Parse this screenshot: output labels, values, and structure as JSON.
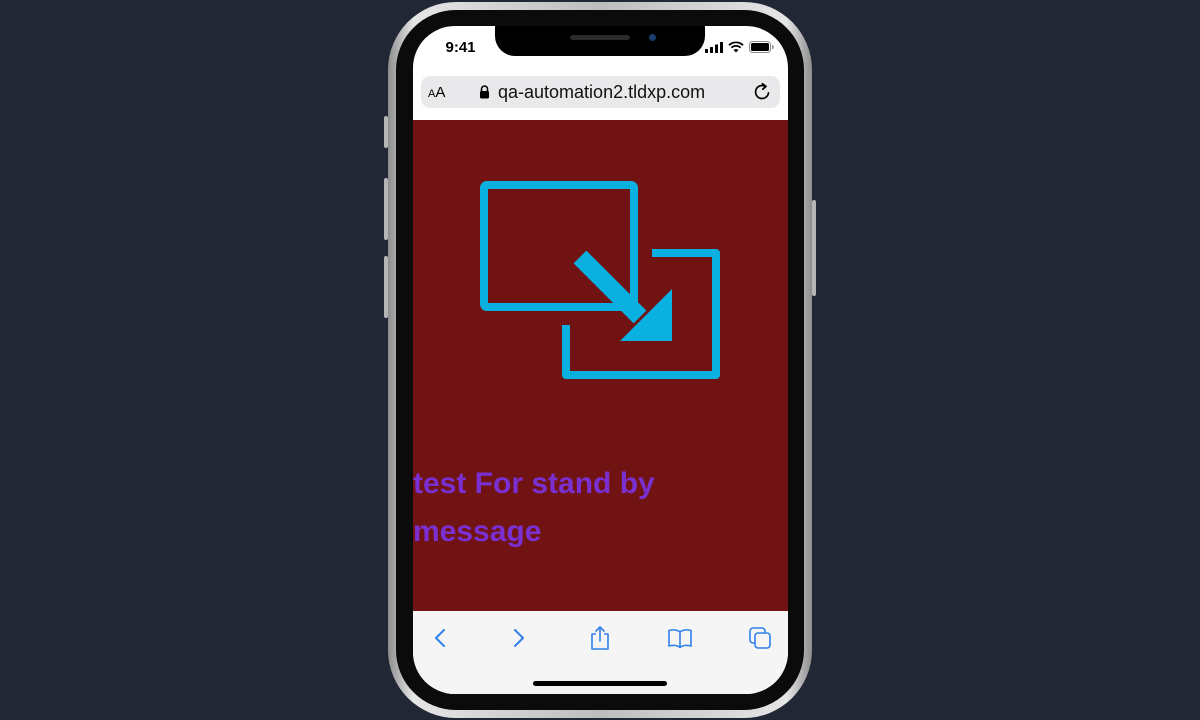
{
  "status_bar": {
    "time": "9:41"
  },
  "browser": {
    "text_size_small": "A",
    "text_size_large": "A",
    "url": "qa-automation2.tldxp.com"
  },
  "page": {
    "background_color": "#721313",
    "icon": "resize-arrow-icon",
    "icon_color": "#0ab0e0",
    "message": " test For stand by message",
    "message_color": "#7a2fd0"
  },
  "toolbar": {
    "items": [
      "back-icon",
      "forward-icon",
      "share-icon",
      "bookmarks-icon",
      "tabs-icon"
    ]
  }
}
